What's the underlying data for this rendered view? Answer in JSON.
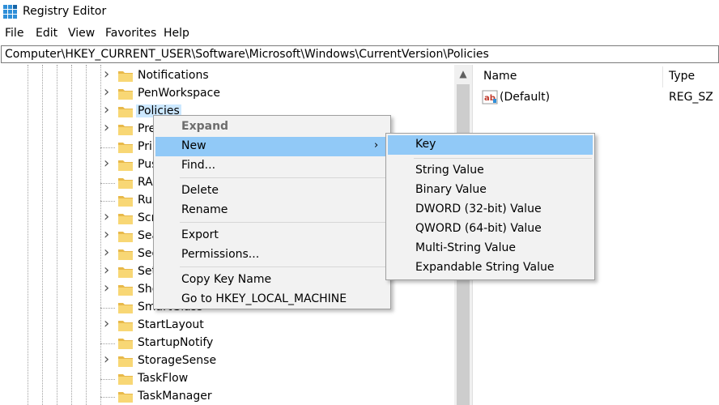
{
  "window": {
    "title": "Registry Editor"
  },
  "menubar": {
    "file": "File",
    "edit": "Edit",
    "view": "View",
    "favorites": "Favorites",
    "help": "Help"
  },
  "address": {
    "path": "Computer\\HKEY_CURRENT_USER\\Software\\Microsoft\\Windows\\CurrentVersion\\Policies"
  },
  "tree": {
    "items": [
      {
        "label": "Notifications",
        "expandable": true
      },
      {
        "label": "PenWorkspace",
        "expandable": true
      },
      {
        "label": "Policies",
        "expandable": true,
        "selected": true
      },
      {
        "label": "Pre",
        "expandable": true
      },
      {
        "label": "Pri",
        "expandable": false
      },
      {
        "label": "Pus",
        "expandable": true
      },
      {
        "label": "RA",
        "expandable": false
      },
      {
        "label": "Ru",
        "expandable": false
      },
      {
        "label": "Scr",
        "expandable": true
      },
      {
        "label": "Sea",
        "expandable": true
      },
      {
        "label": "Sec",
        "expandable": true
      },
      {
        "label": "Set",
        "expandable": true
      },
      {
        "label": "She",
        "expandable": true
      },
      {
        "label": "SmartGlass",
        "expandable": false
      },
      {
        "label": "StartLayout",
        "expandable": true
      },
      {
        "label": "StartupNotify",
        "expandable": false
      },
      {
        "label": "StorageSense",
        "expandable": true
      },
      {
        "label": "TaskFlow",
        "expandable": false
      },
      {
        "label": "TaskManager",
        "expandable": false
      }
    ]
  },
  "values": {
    "headers": {
      "name": "Name",
      "type": "Type"
    },
    "rows": [
      {
        "name": "(Default)",
        "type": "REG_SZ",
        "icon": "string-value-icon"
      }
    ]
  },
  "context_menu": {
    "expand": "Expand",
    "new": "New",
    "find": "Find...",
    "delete": "Delete",
    "rename": "Rename",
    "export": "Export",
    "permissions": "Permissions...",
    "copy_key_name": "Copy Key Name",
    "goto": "Go to HKEY_LOCAL_MACHINE"
  },
  "submenu": {
    "key": "Key",
    "string_value": "String Value",
    "binary_value": "Binary Value",
    "dword": "DWORD (32-bit) Value",
    "qword": "QWORD (64-bit) Value",
    "multi_string": "Multi-String Value",
    "expandable_string": "Expandable String Value"
  },
  "colors": {
    "highlight": "#91c9f7",
    "selection": "#cce8ff",
    "folder": "#f8d775"
  }
}
